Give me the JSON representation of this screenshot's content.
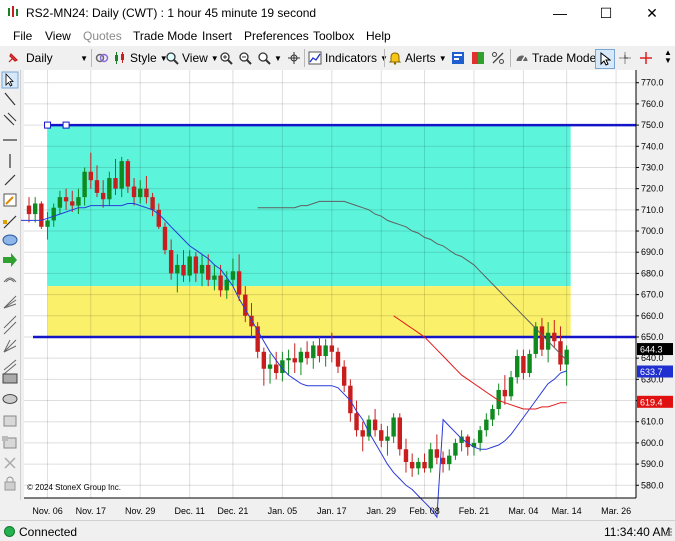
{
  "window": {
    "title": "RS2-MN24: Daily (CWT) : 1 hour 45 minute 19 second",
    "minimize_glyph": "—",
    "maximize_glyph": "☐",
    "close_glyph": "✕"
  },
  "menu": {
    "items": [
      {
        "label": "File",
        "enabled": true
      },
      {
        "label": "View",
        "enabled": true
      },
      {
        "label": "Quotes",
        "enabled": false
      },
      {
        "label": "Trade Mode",
        "enabled": true
      },
      {
        "label": "Insert",
        "enabled": true
      },
      {
        "label": "Preferences",
        "enabled": true
      },
      {
        "label": "Toolbox",
        "enabled": true
      },
      {
        "label": "Help",
        "enabled": true
      }
    ]
  },
  "toolbar": {
    "interval": "Daily",
    "style_label": "Style",
    "view_label": "View",
    "indicators_label": "Indicators",
    "alerts_label": "Alerts",
    "trade_mode_label": "Trade Mode"
  },
  "chart_data": {
    "type": "candlestick",
    "symbol": "RS2-MN24",
    "interval": "Daily",
    "copyright": "© 2024 StoneX Group Inc.",
    "y_ticks": [
      580,
      590,
      600,
      610,
      620,
      630,
      640,
      650,
      660,
      670,
      680,
      690,
      700,
      710,
      720,
      730,
      740,
      750,
      760,
      770
    ],
    "ylim": [
      574,
      776
    ],
    "x_labels": [
      "Nov. 06",
      "Nov. 17",
      "Nov. 29",
      "Dec. 11",
      "Dec. 21",
      "Jan. 05",
      "Jan. 17",
      "Jan. 29",
      "Feb. 08",
      "Feb. 21",
      "Mar. 04",
      "Mar. 14",
      "Mar. 26"
    ],
    "x_label_bars": [
      3,
      10,
      18,
      26,
      33,
      41,
      49,
      57,
      64,
      72,
      80,
      87,
      95
    ],
    "price_labels": [
      {
        "value": 644.3,
        "text": "644.3",
        "color": "#000000"
      },
      {
        "value": 633.7,
        "text": "633.7",
        "color": "#1f2fd0"
      },
      {
        "value": 619.4,
        "text": "619.4",
        "color": "#e01010"
      }
    ],
    "hlines": [
      750,
      650
    ],
    "zones": [
      {
        "from": 674,
        "to": 750,
        "color": "#5cf5dc"
      },
      {
        "from": 650,
        "to": 674,
        "color": "#fbf06a"
      }
    ],
    "series": [
      {
        "name": "MA fast",
        "color": "#2a3ad8",
        "values": [
          705,
          705,
          705,
          705,
          705,
          706,
          707,
          708,
          709,
          710,
          711,
          711,
          712,
          712,
          712,
          712,
          712,
          712,
          713,
          713,
          712,
          711,
          710,
          708,
          705,
          702,
          699,
          696,
          693,
          691,
          689,
          687,
          684,
          682,
          678,
          674,
          668,
          663,
          658,
          653,
          648,
          643,
          639,
          635,
          632,
          630,
          628,
          627,
          627,
          627,
          627,
          627,
          626,
          623,
          620,
          615,
          611,
          605,
          600,
          595,
          590,
          586,
          583,
          580,
          578,
          575,
          572,
          569,
          565,
          611,
          608,
          605,
          602,
          600,
          598,
          597,
          597,
          598,
          599,
          601,
          604,
          608,
          612,
          616,
          620,
          624,
          628,
          630,
          633,
          634
        ]
      },
      {
        "name": "MA medium",
        "color": "#606060",
        "values": [
          711,
          711,
          711,
          711,
          711,
          711,
          711,
          712,
          712,
          713,
          714,
          714,
          714,
          714,
          714,
          713,
          712,
          711,
          710,
          708,
          707,
          705,
          704,
          703,
          702,
          700,
          699,
          697,
          696,
          694,
          693,
          691,
          689,
          688,
          686,
          684,
          681,
          678,
          675,
          672,
          669,
          666,
          663,
          660,
          657,
          654,
          651,
          648,
          645,
          642,
          639
        ]
      },
      {
        "name": "MA slow",
        "color": "#e01a1a",
        "values": [
          660,
          658,
          656,
          654,
          652,
          650,
          647,
          644,
          641,
          638,
          635,
          632,
          630,
          628,
          626,
          624,
          622,
          620,
          619,
          618,
          617,
          616,
          616,
          616,
          617,
          617,
          618,
          619,
          619
        ]
      }
    ],
    "candles": [
      [
        712,
        716,
        704,
        708
      ],
      [
        708,
        716,
        704,
        713
      ],
      [
        713,
        714,
        701,
        702
      ],
      [
        702,
        709,
        696,
        705
      ],
      [
        705,
        713,
        702,
        711
      ],
      [
        711,
        719,
        708,
        716
      ],
      [
        716,
        720,
        710,
        714
      ],
      [
        714,
        719,
        709,
        712
      ],
      [
        712,
        720,
        708,
        716
      ],
      [
        716,
        730,
        712,
        728
      ],
      [
        728,
        737,
        720,
        724
      ],
      [
        724,
        731,
        716,
        718
      ],
      [
        718,
        724,
        711,
        715
      ],
      [
        715,
        728,
        712,
        725
      ],
      [
        725,
        734,
        717,
        720
      ],
      [
        720,
        735,
        716,
        733
      ],
      [
        733,
        734,
        718,
        721
      ],
      [
        721,
        725,
        712,
        716
      ],
      [
        716,
        724,
        713,
        720
      ],
      [
        720,
        726,
        713,
        716
      ],
      [
        716,
        718,
        707,
        710
      ],
      [
        710,
        713,
        701,
        702
      ],
      [
        702,
        704,
        689,
        691
      ],
      [
        691,
        696,
        677,
        680
      ],
      [
        680,
        689,
        671,
        684
      ],
      [
        684,
        691,
        676,
        679
      ],
      [
        679,
        691,
        676,
        688
      ],
      [
        688,
        690,
        676,
        680
      ],
      [
        680,
        689,
        674,
        684
      ],
      [
        684,
        689,
        674,
        677
      ],
      [
        677,
        684,
        672,
        679
      ],
      [
        679,
        684,
        669,
        672
      ],
      [
        672,
        681,
        668,
        677
      ],
      [
        677,
        687,
        674,
        681
      ],
      [
        681,
        689,
        667,
        670
      ],
      [
        670,
        674,
        657,
        660
      ],
      [
        660,
        666,
        650,
        655
      ],
      [
        655,
        657,
        640,
        643
      ],
      [
        643,
        645,
        627,
        635
      ],
      [
        635,
        642,
        628,
        637
      ],
      [
        637,
        643,
        630,
        633
      ],
      [
        633,
        643,
        629,
        639
      ],
      [
        639,
        644,
        632,
        640
      ],
      [
        640,
        647,
        633,
        638
      ],
      [
        638,
        645,
        632,
        643
      ],
      [
        643,
        648,
        637,
        640
      ],
      [
        640,
        648,
        635,
        646
      ],
      [
        646,
        650,
        638,
        641
      ],
      [
        641,
        649,
        636,
        646
      ],
      [
        646,
        652,
        638,
        643
      ],
      [
        643,
        645,
        633,
        636
      ],
      [
        636,
        639,
        624,
        627
      ],
      [
        627,
        630,
        610,
        614
      ],
      [
        614,
        620,
        603,
        606
      ],
      [
        606,
        610,
        596,
        603
      ],
      [
        603,
        613,
        601,
        611
      ],
      [
        611,
        616,
        603,
        606
      ],
      [
        606,
        609,
        598,
        601
      ],
      [
        601,
        608,
        594,
        603
      ],
      [
        603,
        614,
        600,
        612
      ],
      [
        612,
        614,
        594,
        597
      ],
      [
        597,
        602,
        586,
        591
      ],
      [
        591,
        595,
        584,
        588
      ],
      [
        588,
        593,
        585,
        591
      ],
      [
        591,
        595,
        586,
        588
      ],
      [
        588,
        600,
        586,
        597
      ],
      [
        597,
        604,
        590,
        593
      ],
      [
        593,
        596,
        586,
        590
      ],
      [
        590,
        597,
        587,
        594
      ],
      [
        594,
        602,
        592,
        600
      ],
      [
        600,
        606,
        596,
        603
      ],
      [
        603,
        604,
        594,
        598
      ],
      [
        598,
        602,
        594,
        600
      ],
      [
        600,
        608,
        596,
        606
      ],
      [
        606,
        614,
        603,
        611
      ],
      [
        611,
        618,
        608,
        616
      ],
      [
        616,
        628,
        613,
        625
      ],
      [
        625,
        632,
        618,
        622
      ],
      [
        622,
        634,
        620,
        631
      ],
      [
        631,
        644,
        628,
        641
      ],
      [
        641,
        644,
        630,
        633
      ],
      [
        633,
        644,
        631,
        642
      ],
      [
        642,
        657,
        640,
        655
      ],
      [
        655,
        659,
        641,
        644
      ],
      [
        644,
        657,
        638,
        652
      ],
      [
        652,
        658,
        645,
        648
      ],
      [
        648,
        655,
        634,
        637
      ],
      [
        637,
        646,
        627,
        644
      ]
    ]
  },
  "status": {
    "connection": "Connected",
    "time": "11:34:40 AM"
  }
}
